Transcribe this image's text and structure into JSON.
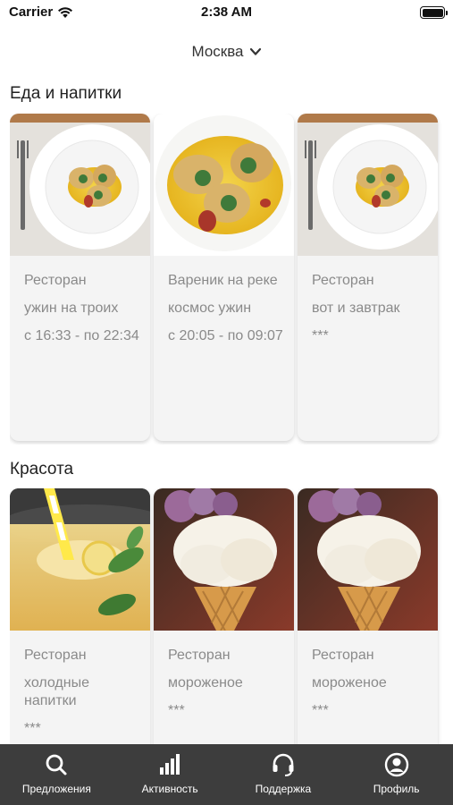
{
  "status_bar": {
    "carrier": "Carrier",
    "time": "2:38 AM"
  },
  "header": {
    "city": "Москва",
    "chevron_icon": "chevron-down-icon"
  },
  "sections": [
    {
      "title": "Еда и напитки",
      "cards": [
        {
          "image": "food-plate",
          "line1": "Ресторан",
          "line2": "ужин на троих",
          "line3": "с 16:33 - по 22:34"
        },
        {
          "image": "food-closeup",
          "line1": "Вареник на реке",
          "line2": "космос ужин",
          "line3": "с 20:05 - по 09:07"
        },
        {
          "image": "food-plate",
          "line1": "Ресторан",
          "line2": "вот и завтрак",
          "line3": "***"
        }
      ]
    },
    {
      "title": "Красота",
      "cards": [
        {
          "image": "lemonade",
          "line1": "Ресторан",
          "line2": "холодные напитки",
          "line3": "***"
        },
        {
          "image": "ice-cream",
          "line1": "Ресторан",
          "line2": "мороженое",
          "line3": "***"
        },
        {
          "image": "ice-cream",
          "line1": "Ресторан",
          "line2": "мороженое",
          "line3": "***"
        }
      ]
    }
  ],
  "tab_bar": {
    "tabs": [
      {
        "label": "Предложения",
        "icon": "search-icon"
      },
      {
        "label": "Активность",
        "icon": "bar-chart-icon"
      },
      {
        "label": "Поддержка",
        "icon": "headset-icon"
      },
      {
        "label": "Профиль",
        "icon": "profile-icon"
      }
    ]
  },
  "colors": {
    "tab_bar_bg": "#3d3d3d",
    "card_bg": "#f4f4f4",
    "card_text": "#8a8a8a"
  }
}
